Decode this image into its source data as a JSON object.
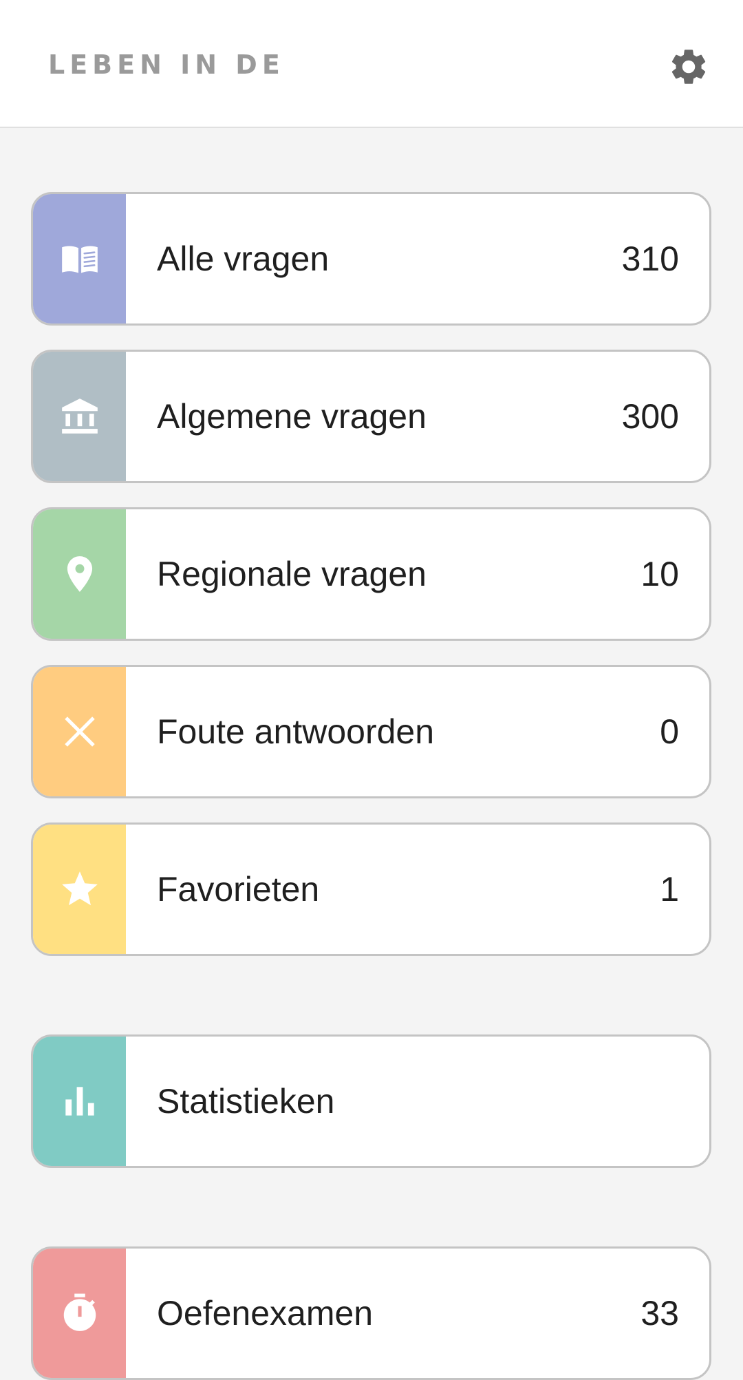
{
  "header": {
    "logo_text": "LEBEN IN DE",
    "settings_icon": "gear-icon"
  },
  "colors": {
    "all_questions": "#9fa8da",
    "general_questions": "#b0bec5",
    "regional_questions": "#a5d6a7",
    "wrong_answers": "#ffcc80",
    "favorites": "#ffe082",
    "statistics": "#80cbc4",
    "practice_exam": "#ef9a9a"
  },
  "menu": {
    "all_questions": {
      "label": "Alle vragen",
      "count": "310",
      "icon": "open-book-icon"
    },
    "general_questions": {
      "label": "Algemene vragen",
      "count": "300",
      "icon": "institution-icon"
    },
    "regional_questions": {
      "label": "Regionale vragen",
      "count": "10",
      "icon": "location-pin-icon"
    },
    "wrong_answers": {
      "label": "Foute antwoorden",
      "count": "0",
      "icon": "close-icon"
    },
    "favorites": {
      "label": "Favorieten",
      "count": "1",
      "icon": "star-icon"
    },
    "statistics": {
      "label": "Statistieken",
      "icon": "bar-chart-icon"
    },
    "practice_exam": {
      "label": "Oefenexamen",
      "count": "33",
      "icon": "stopwatch-icon"
    }
  }
}
